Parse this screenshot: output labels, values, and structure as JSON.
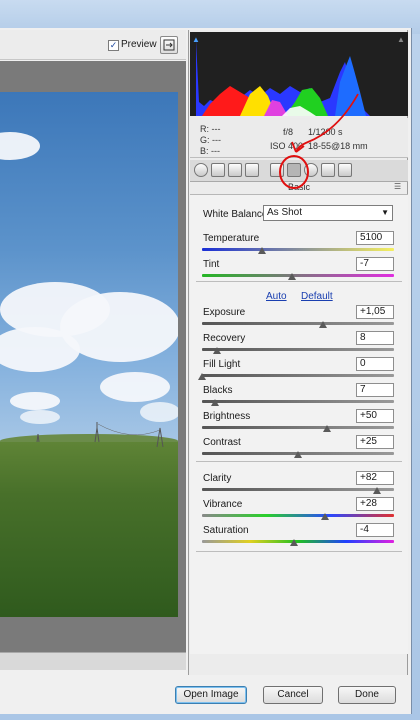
{
  "toolbar": {
    "preview_label": "Preview",
    "preview_checked": "✓"
  },
  "histogram": {
    "clip_left": "▲",
    "clip_right": "▲"
  },
  "readout": {
    "r": "R:  ---",
    "g": "G:  ---",
    "b": "B:  ---",
    "aperture": "f/8",
    "shutter": "1/1200 s",
    "iso": "ISO 400",
    "lens": "18-55@18 mm"
  },
  "panel": {
    "section_title": "Basic",
    "menu_icon": "☰"
  },
  "white_balance": {
    "label": "White Balance:",
    "value": "As Shot"
  },
  "auto_label": "Auto",
  "default_label": "Default",
  "sliders": [
    {
      "label": "Temperature",
      "value": "5100",
      "level": 0.31
    },
    {
      "label": "Tint",
      "value": "-7",
      "level": 0.47
    },
    {
      "label": "Exposure",
      "value": "+1,05",
      "level": 0.63
    },
    {
      "label": "Recovery",
      "value": "8",
      "level": 0.08
    },
    {
      "label": "Fill Light",
      "value": "0",
      "level": 0.0
    },
    {
      "label": "Blacks",
      "value": "7",
      "level": 0.07
    },
    {
      "label": "Brightness",
      "value": "+50",
      "level": 0.65
    },
    {
      "label": "Contrast",
      "value": "+25",
      "level": 0.5
    },
    {
      "label": "Clarity",
      "value": "+82",
      "level": 0.91
    },
    {
      "label": "Vibrance",
      "value": "+28",
      "level": 0.64
    },
    {
      "label": "Saturation",
      "value": "-4",
      "level": 0.48
    }
  ],
  "buttons": {
    "open_image": "Open Image",
    "cancel": "Cancel",
    "done": "Done"
  },
  "colors": {
    "accent": "#2c5bbd",
    "annotation": "#e01010"
  }
}
